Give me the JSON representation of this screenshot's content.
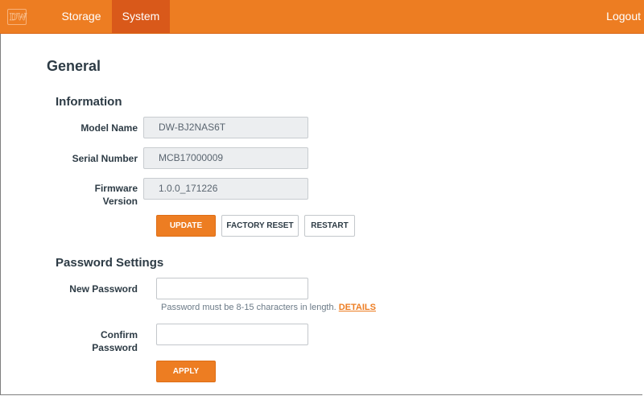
{
  "nav": {
    "logo_text": "DW",
    "tabs": [
      {
        "label": "Storage",
        "active": false
      },
      {
        "label": "System",
        "active": true
      }
    ],
    "logout_label": "Logout"
  },
  "page": {
    "title": "General"
  },
  "information": {
    "title": "Information",
    "model_name": {
      "label": "Model Name",
      "value": "DW-BJ2NAS6T"
    },
    "serial_number": {
      "label": "Serial Number",
      "value": "MCB17000009"
    },
    "firmware_version": {
      "label_line1": "Firmware",
      "label_line2": "Version",
      "value": "1.0.0_171226"
    },
    "buttons": {
      "update": "UPDATE",
      "factory_reset": "FACTORY RESET",
      "restart": "RESTART"
    }
  },
  "password": {
    "title": "Password Settings",
    "new_password": {
      "label": "New Password",
      "value": "",
      "placeholder": ""
    },
    "hint": "Password must be 8-15 characters in length.",
    "details_link": "DETAILS",
    "confirm_password": {
      "label_line1": "Confirm",
      "label_line2": "Password",
      "value": "",
      "placeholder": ""
    },
    "apply_label": "APPLY"
  },
  "colors": {
    "accent": "#ed7d22",
    "active_tab": "#d9591a",
    "text": "#2d3b45"
  }
}
